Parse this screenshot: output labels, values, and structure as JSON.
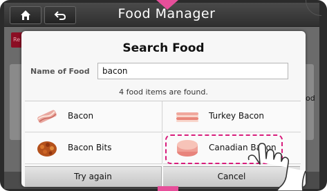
{
  "header": {
    "title": "Food Manager",
    "home_icon": "home-icon",
    "back_icon": "back-arrow-icon"
  },
  "background": {
    "tab_label": "Re",
    "side_text": "od"
  },
  "dialog": {
    "title": "Search Food",
    "name_label": "Name of Food",
    "search_value": "bacon",
    "result_text": "4 food items are found.",
    "items": [
      {
        "label": "Bacon",
        "icon": "bacon-icon"
      },
      {
        "label": "Turkey Bacon",
        "icon": "turkey-bacon-icon"
      },
      {
        "label": "Bacon Bits",
        "icon": "bacon-bits-icon"
      },
      {
        "label": "Canadian Bacon",
        "icon": "canadian-bacon-icon"
      }
    ],
    "try_again_label": "Try again",
    "cancel_label": "Cancel"
  },
  "colors": {
    "highlight": "#d81b7b",
    "pointer": "#e64f9a"
  }
}
